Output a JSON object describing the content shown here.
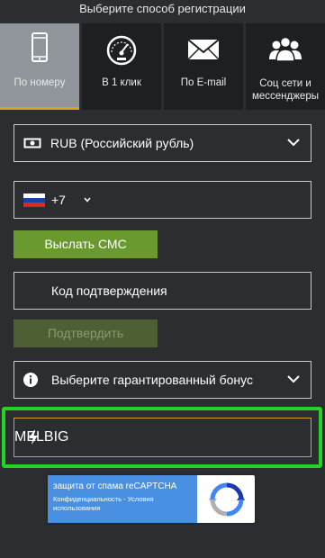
{
  "header": {
    "title": "Выберите способ регистрации"
  },
  "tabs": [
    {
      "label": "По номеру",
      "icon": "smartphone-icon",
      "active": true
    },
    {
      "label": "В 1 клик",
      "icon": "speedometer-icon",
      "active": false
    },
    {
      "label": "По E-mail",
      "icon": "envelope-icon",
      "active": false
    },
    {
      "label": "Соц сети и мессенджеры",
      "icon": "people-icon",
      "active": false
    }
  ],
  "currency": {
    "value": "RUB (Российский рубль)",
    "icon": "banknote-icon"
  },
  "phone": {
    "country_code": "+7",
    "flag": "russia-flag-icon"
  },
  "send_sms": {
    "label": "Выслать СМС"
  },
  "confirmation_code": {
    "placeholder": "Код подтверждения"
  },
  "confirm": {
    "label": "Подтвердить"
  },
  "bonus": {
    "value": "Выберите гарантированный бонус",
    "icon": "info-icon"
  },
  "promo": {
    "value": "MELBIG",
    "icon": "lightning-icon"
  },
  "recaptcha": {
    "line1": "защита от спама reCAPTCHA",
    "line2": "Конфиденциальность - Условия использования"
  },
  "colors": {
    "background": "#2b2d30",
    "tab_inactive": "#1d1f22",
    "tab_active": "#8f959a",
    "accent": "#d6a21e",
    "button_green": "#6a9a2d",
    "highlight": "#23d423"
  }
}
